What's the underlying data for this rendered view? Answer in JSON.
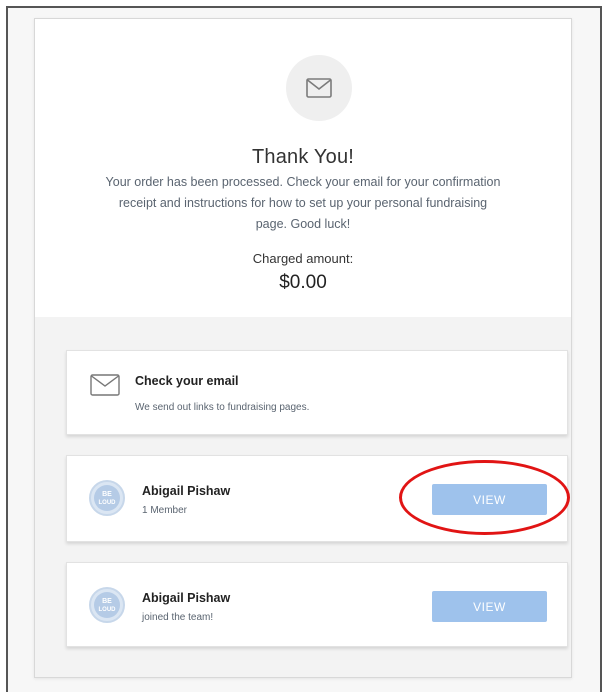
{
  "confirmation": {
    "icon": "envelope-icon",
    "title": "Thank You!",
    "message": "Your order has been processed. Check your email for your confirmation receipt and instructions for how to set up your personal fundraising page. Good luck!",
    "charged_label": "Charged amount:",
    "charged_amount": "$0.00"
  },
  "email_panel": {
    "icon": "envelope-icon",
    "title": "Check your email",
    "subtitle": "We send out links to fundraising pages."
  },
  "teams": [
    {
      "avatar": "be-loud-logo",
      "name": "Abigail Pishaw",
      "subtitle": "1 Member",
      "button_label": "VIEW"
    },
    {
      "avatar": "be-loud-logo",
      "name": "Abigail Pishaw",
      "subtitle": "joined the team!",
      "button_label": "VIEW"
    }
  ],
  "avatar_text": {
    "line1": "BE",
    "line2": "LOUD"
  },
  "colors": {
    "button": "#9ec2ec",
    "highlight": "#e11414",
    "panel_background": "#f3f3f3"
  }
}
